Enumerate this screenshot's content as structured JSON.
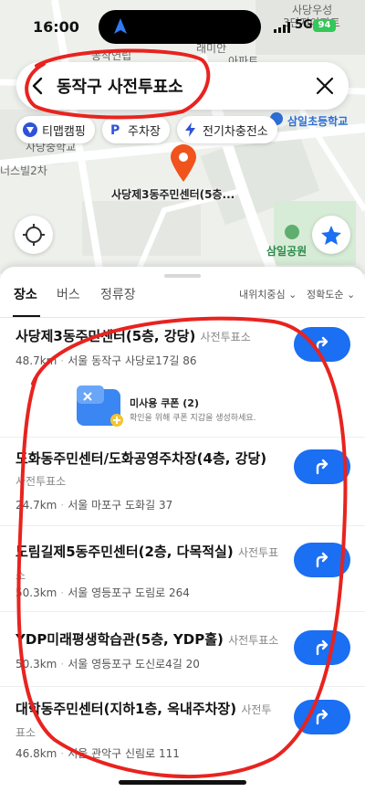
{
  "status_bar": {
    "time": "16:00",
    "network": "5G",
    "battery": "94"
  },
  "search": {
    "query": "동작구 사전투표소"
  },
  "chips": [
    {
      "label": "티맵캠핑",
      "icon": "tmap-icon"
    },
    {
      "label": "주차장",
      "icon": "parking-icon"
    },
    {
      "label": "전기차충전소",
      "icon": "ev-charging-icon"
    }
  ],
  "map": {
    "pin_label": "사당제3동주민센터(5층...",
    "labels": {
      "school": "삼일초등학교",
      "park": "삼일공원",
      "top_right_1": "사당우성",
      "top_right_2": "3단지아파트",
      "apartment": "래미안",
      "apartment2": "아파트",
      "left_1": "사당중학교",
      "left_2": "너스빌2차",
      "top_left": "동작연립"
    }
  },
  "tabs": [
    {
      "label": "장소",
      "active": true
    },
    {
      "label": "버스",
      "active": false
    },
    {
      "label": "정류장",
      "active": false
    }
  ],
  "sort": {
    "proximity": "내위치중심",
    "accuracy": "정확도순"
  },
  "results": [
    {
      "name": "사당제3동주민센터(5층, 강당)",
      "category": "사전투표소",
      "distance": "48.7km",
      "address": "서울 동작구 사당로17길 86"
    },
    {
      "name": "도화동주민센터/도화공영주차장(4층, 강당)",
      "category": "사전투표소",
      "distance": "24.7km",
      "address": "서울 마포구 도화길 37"
    },
    {
      "name": "도림길제5동주민센터(2층, 다목적실)",
      "category": "사전투표소",
      "distance": "50.3km",
      "address": "서울 영등포구 도림로 264"
    },
    {
      "name": "YDP미래평생학습관(5층, YDP홀)",
      "category": "사전투표소",
      "distance": "50.3km",
      "address": "서울 영등포구 도신로4길 20"
    },
    {
      "name": "대학동주민센터(지하1층, 옥내주차장)",
      "category": "사전투표소",
      "distance": "46.8km",
      "address": "서울 관악구 신림로 111"
    }
  ],
  "coupon": {
    "title": "미사용 쿠폰 (2)",
    "description": "확인을 위해 쿠폰 지갑을 생성하세요."
  },
  "colors": {
    "accent": "#1a6ff2",
    "pin": "#f0531c",
    "annotation": "#e8231f"
  }
}
